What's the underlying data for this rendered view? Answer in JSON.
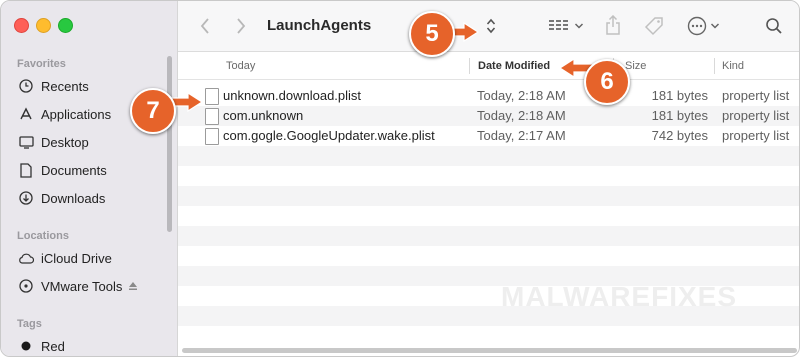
{
  "window": {
    "title": "LaunchAgents"
  },
  "sidebar": {
    "sections": [
      {
        "heading": "Favorites",
        "items": [
          {
            "label": "Recents",
            "icon": "clock-icon"
          },
          {
            "label": "Applications",
            "icon": "applications-icon"
          },
          {
            "label": "Desktop",
            "icon": "desktop-icon"
          },
          {
            "label": "Documents",
            "icon": "document-icon"
          },
          {
            "label": "Downloads",
            "icon": "download-icon"
          }
        ]
      },
      {
        "heading": "Locations",
        "items": [
          {
            "label": "iCloud Drive",
            "icon": "cloud-icon"
          },
          {
            "label": "VMware Tools",
            "icon": "disk-icon"
          }
        ]
      },
      {
        "heading": "Tags",
        "items": [
          {
            "label": "Red",
            "icon": "tag-dot-icon",
            "color": "#1a1a1a"
          }
        ]
      }
    ]
  },
  "columns": {
    "name": "Today",
    "date": "Date Modified",
    "size": "Size",
    "kind": "Kind"
  },
  "files": [
    {
      "name": "unknown.download.plist",
      "date": "Today, 2:18 AM",
      "size": "181 bytes",
      "kind": "property list"
    },
    {
      "name": "com.unknown",
      "date": "Today, 2:18 AM",
      "size": "181 bytes",
      "kind": "property list"
    },
    {
      "name": "com.gogle.GoogleUpdater.wake.plist",
      "date": "Today, 2:17 AM",
      "size": "742 bytes",
      "kind": "property list"
    }
  ],
  "annotations": {
    "badge5": "5",
    "badge6": "6",
    "badge7": "7",
    "color": "#e6632a"
  },
  "watermark": "MALWAREFIXES"
}
